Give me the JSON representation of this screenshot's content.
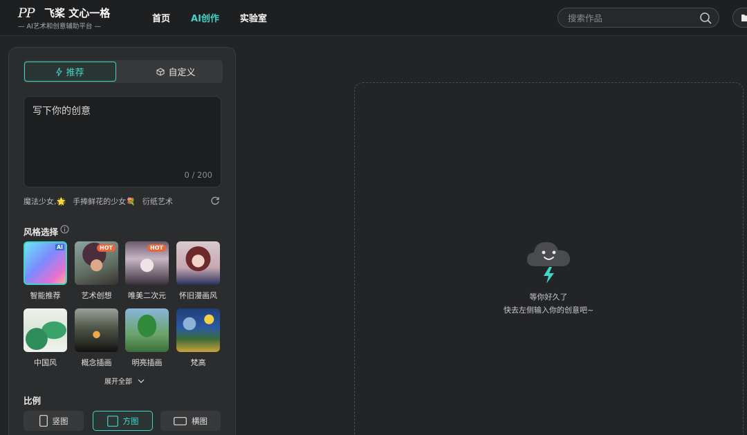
{
  "header": {
    "logo_mark": "PP",
    "logo_title": "飞桨 文心一格",
    "logo_subtitle": "— AI艺术和创意辅助平台 —",
    "nav": [
      {
        "label": "首页",
        "active": false
      },
      {
        "label": "AI创作",
        "active": true
      },
      {
        "label": "实验室",
        "active": false
      }
    ],
    "search_placeholder": "搜索作品"
  },
  "panel": {
    "mode_tabs": {
      "recommend": "推荐",
      "custom": "自定义"
    },
    "prompt": {
      "placeholder": "写下你的创意",
      "counter": "0 / 200"
    },
    "suggestions": [
      "魔法少女,🌟",
      "手捧鲜花的少女💐",
      "衍纸艺术"
    ],
    "style_section_title": "风格选择",
    "styles": [
      {
        "label": "智能推荐",
        "badge": "AI"
      },
      {
        "label": "艺术创想",
        "badge": "HOT"
      },
      {
        "label": "唯美二次元",
        "badge": "HOT"
      },
      {
        "label": "怀旧漫画风",
        "badge": ""
      },
      {
        "label": "中国风",
        "badge": ""
      },
      {
        "label": "概念插画",
        "badge": ""
      },
      {
        "label": "明亮插画",
        "badge": ""
      },
      {
        "label": "梵高",
        "badge": ""
      }
    ],
    "expand_label": "展开全部",
    "ratio_section_title": "比例",
    "ratios": [
      {
        "label": "竖图",
        "active": false
      },
      {
        "label": "方图",
        "active": true
      },
      {
        "label": "横图",
        "active": false
      }
    ]
  },
  "canvas": {
    "empty_title": "等你好久了",
    "empty_subtitle": "快去左侧输入你的创意吧~"
  },
  "colors": {
    "accent": "#3fd6c7",
    "background": "#232426",
    "panel": "#2b2c2e",
    "hot_badge": "#e8663a"
  }
}
